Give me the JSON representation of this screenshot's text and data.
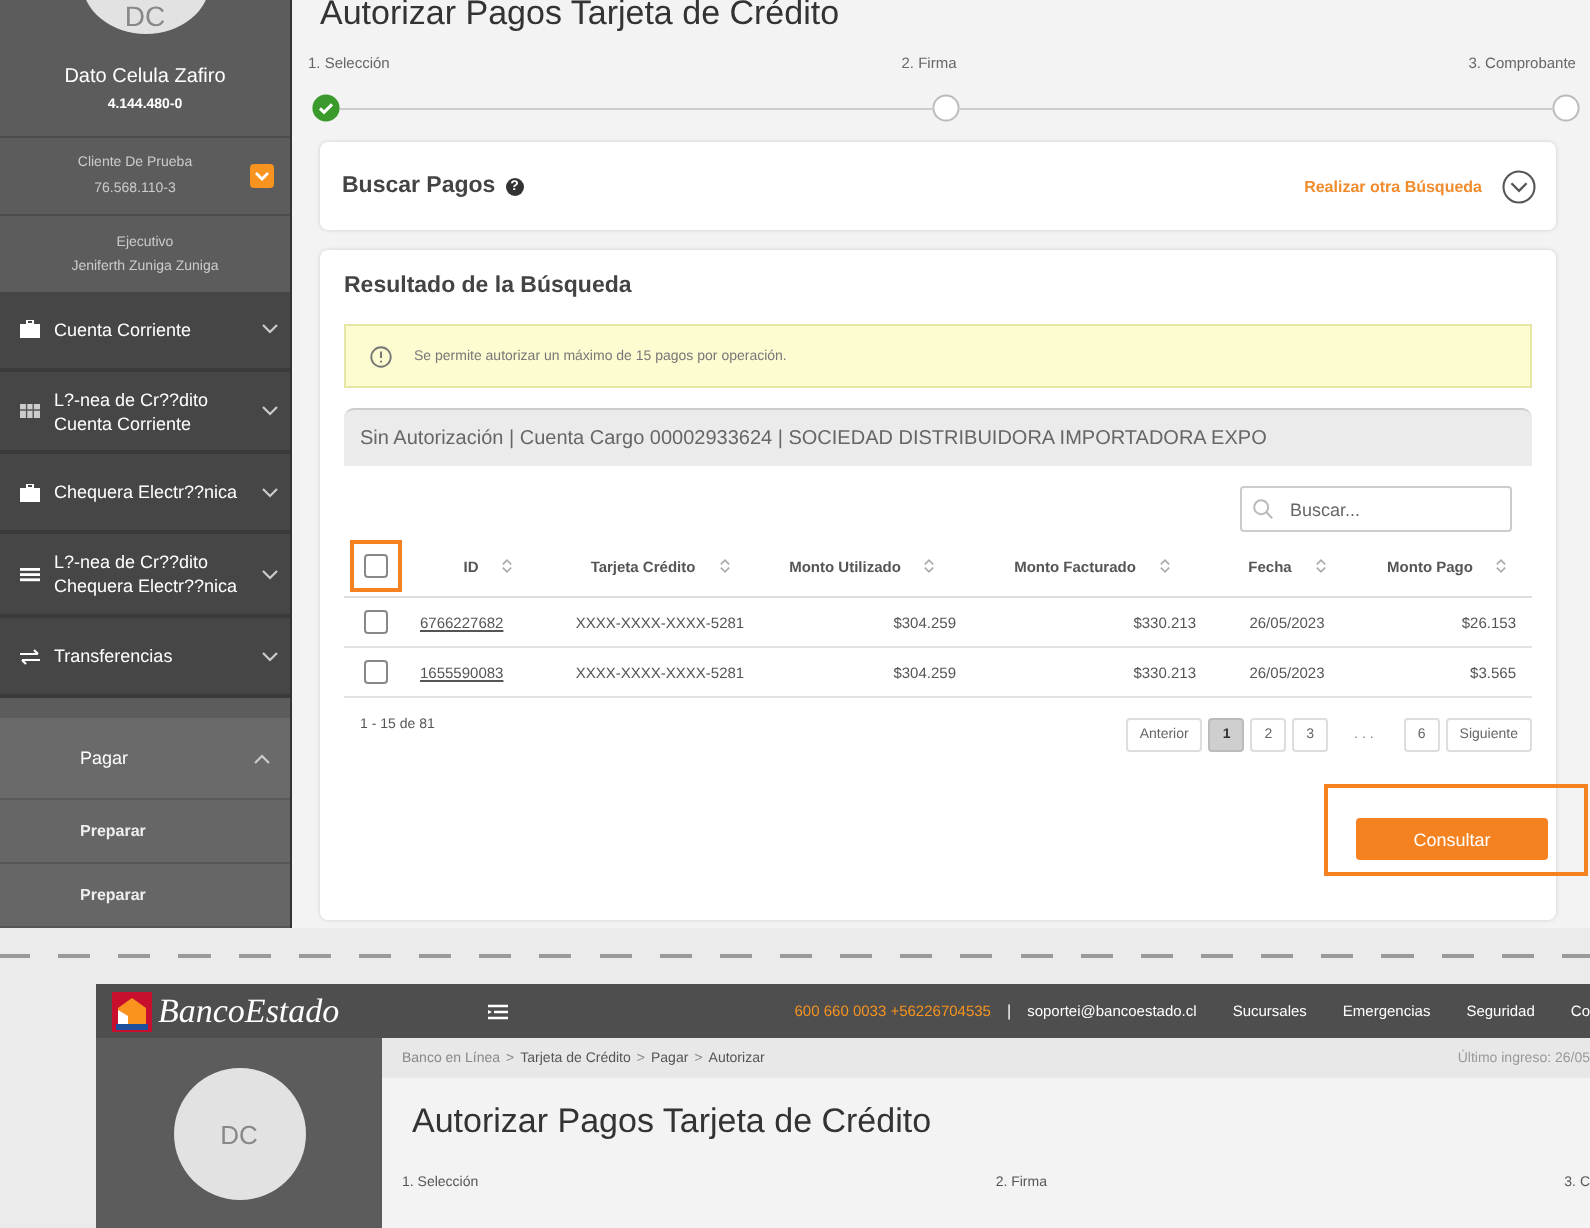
{
  "top": {
    "sidebar": {
      "avatar": "DC",
      "user_name": "Dato Celula Zafiro",
      "user_rut": "4.144.480-0",
      "client_name": "Cliente De Prueba",
      "client_rut": "76.568.110-3",
      "executive_label": "Ejecutivo",
      "executive_name": "Jeniferth Zuniga Zuniga",
      "menu": [
        {
          "label": "Cuenta Corriente",
          "expanded": false
        },
        {
          "label": "L?-nea de Cr??dito Cuenta Corriente",
          "expanded": false
        },
        {
          "label": "Chequera Electr??nica",
          "expanded": false
        },
        {
          "label": "L?-nea de Cr??dito Chequera Electr??nica",
          "expanded": false
        },
        {
          "label": "Transferencias",
          "expanded": false
        },
        {
          "label": "Pagar",
          "expanded": true,
          "children": [
            {
              "label": "Preparar"
            },
            {
              "label": "Preparar"
            }
          ]
        }
      ]
    },
    "page_title": "Autorizar Pagos Tarjeta de Crédito",
    "steps": [
      {
        "label": "1. Selección",
        "done": true
      },
      {
        "label": "2. Firma",
        "done": false
      },
      {
        "label": "3. Comprobante",
        "done": false
      }
    ],
    "search_card": {
      "title": "Buscar Pagos",
      "help": "?",
      "link": "Realizar otra Búsqueda",
      "expanded": false
    },
    "results": {
      "title": "Resultado de la Búsqueda",
      "alert": "Se permite autorizar un máximo de 15 pagos por operación.",
      "account_bar": "Sin Autorización | Cuenta Cargo 00002933624 | SOCIEDAD DISTRIBUIDORA IMPORTADORA EXPO",
      "search": {
        "placeholder": "Buscar..."
      },
      "select_all": {
        "checked": false,
        "highlighted": true
      },
      "columns": [
        "ID",
        "Tarjeta Crédito",
        "Monto Utilizado",
        "Monto Facturado",
        "Fecha",
        "Monto Pago"
      ],
      "rows": [
        {
          "checked": false,
          "cells": [
            "6766227682",
            "XXXX-XXXX-XXXX-5281",
            "$304.259",
            "$330.213",
            "26/05/2023",
            "$26.153"
          ]
        },
        {
          "checked": false,
          "cells": [
            "1655590083",
            "XXXX-XXXX-XXXX-5281",
            "$304.259",
            "$330.213",
            "26/05/2023",
            "$3.565"
          ]
        }
      ],
      "range": "1 - 15 de 81",
      "pages": [
        {
          "label": "Anterior",
          "kind": "page",
          "selected": false
        },
        {
          "label": "1",
          "kind": "page",
          "selected": true
        },
        {
          "label": "2",
          "kind": "page",
          "selected": false
        },
        {
          "label": "3",
          "kind": "page",
          "selected": false
        },
        {
          "label": "...",
          "kind": "ellipsis"
        },
        {
          "label": "6",
          "kind": "page",
          "selected": false
        },
        {
          "label": "Siguiente",
          "kind": "page",
          "selected": false
        }
      ],
      "submit": {
        "label": "Consultar",
        "highlighted": true
      }
    }
  },
  "bottom": {
    "header": {
      "logo": "BancoEstado",
      "phone": "600 660 0033 +56226704535",
      "separator": "|",
      "email": "soportei@bancoestado.cl",
      "nav": [
        "Sucursales",
        "Emergencias",
        "Seguridad",
        "Co"
      ]
    },
    "breadcrumb": [
      "Banco en Línea",
      "Tarjeta de Crédito",
      "Pagar",
      "Autorizar"
    ],
    "crumb_separator": ">",
    "last_login": "Último ingreso: 26/05",
    "avatar": "DC",
    "page_title": "Autorizar Pagos Tarjeta de Crédito",
    "steps": [
      "1. Selección",
      "2. Firma",
      "3. C"
    ]
  }
}
